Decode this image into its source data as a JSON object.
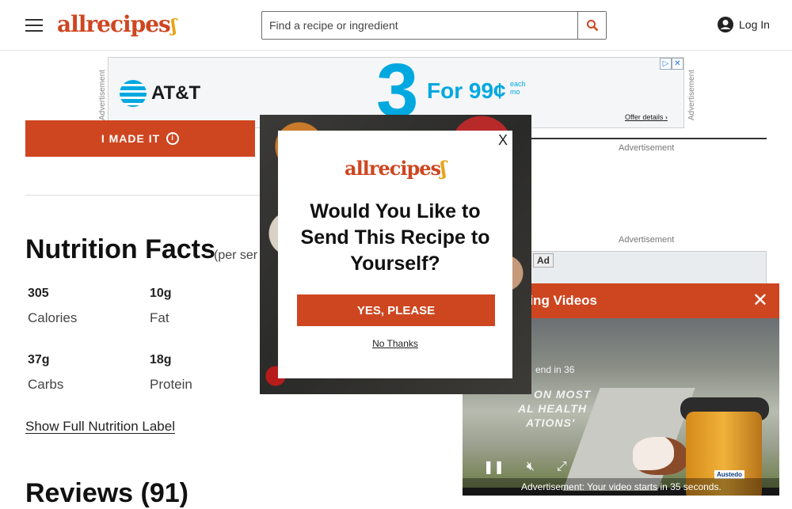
{
  "header": {
    "logo_text": "allrecipes",
    "search_placeholder": "Find a recipe or ingredient",
    "login_label": "Log In"
  },
  "ad_banner": {
    "side_label": "Advertisement",
    "brand": "AT&T",
    "big_number": "3",
    "offer": "For 99¢",
    "each": "each",
    "mo": "mo",
    "offer_details": "Offer details"
  },
  "recipe": {
    "made_it_label": "I MADE IT",
    "nutrition_title": "Nutrition Facts",
    "per_serving": "(per ser",
    "nutrition": [
      {
        "value": "305",
        "label": "Calories"
      },
      {
        "value": "10g",
        "label": "Fat"
      },
      {
        "value": "37g",
        "label": "Carbs"
      },
      {
        "value": "18g",
        "label": "Protein"
      }
    ],
    "full_label_link": "Show Full Nutrition Label",
    "reviews_title": "Reviews (91)"
  },
  "right_rail": {
    "advertisement_label_1": "Advertisement",
    "advertisement_label_2": "Advertisement",
    "ad_tag": "Ad"
  },
  "video": {
    "title": "ding Videos",
    "next_text": "end in 36",
    "overlay_line1": "ON MOST",
    "overlay_line2": "AL HEALTH",
    "overlay_line3": "ATIONS'",
    "ad_countdown": "Advertisement: Your video starts in 35 seconds.",
    "sponsor": "Austedo"
  },
  "modal": {
    "logo_text": "allrecipes",
    "close_label": "X",
    "title": "Would You Like to Send This Recipe to Yourself?",
    "yes_label": "YES, PLEASE",
    "no_label": "No Thanks"
  },
  "colors": {
    "brand_orange": "#ce4620",
    "att_blue": "#00a8e0"
  }
}
